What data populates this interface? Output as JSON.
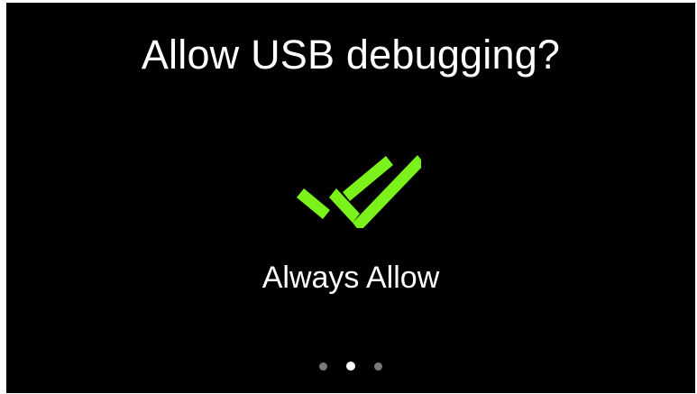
{
  "dialog": {
    "title": "Allow USB debugging?"
  },
  "page": {
    "label": "Always Allow",
    "icon": "double-check-icon",
    "accent_color": "#7bf21a"
  },
  "pager": {
    "count": 3,
    "active_index": 1,
    "active_color": "#ffffff",
    "inactive_color": "#7a7a7a"
  }
}
